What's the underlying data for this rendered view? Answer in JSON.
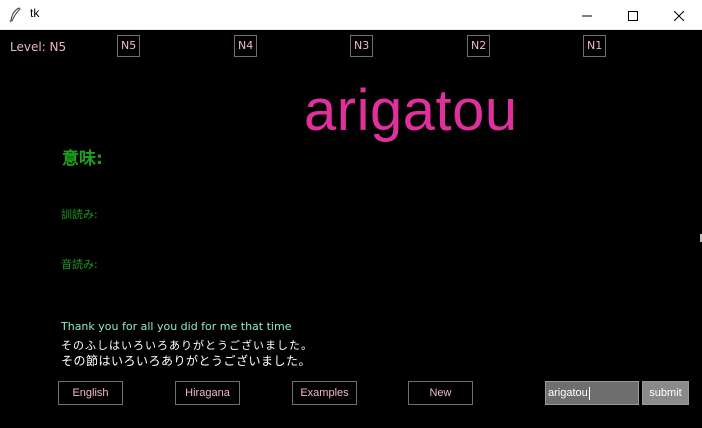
{
  "window": {
    "title": "tk",
    "icons": {
      "app": "feather-icon",
      "minimize": "minimize-icon",
      "maximize": "maximize-icon",
      "close": "close-icon"
    }
  },
  "level": {
    "label": "Level: N5",
    "buttons": [
      "N5",
      "N4",
      "N3",
      "N2",
      "N1"
    ]
  },
  "word": "arigatou",
  "meaning_label": "意味:",
  "kun_label": "訓読み:",
  "on_label": "音読み:",
  "example": {
    "english": "Thank you for all you did for me that time",
    "kana": "そのふしはいろいろありがとうございました。",
    "kanji": "その節はいろいろありがとうございました。"
  },
  "actions": {
    "english": "English",
    "hiragana": "Hiragana",
    "examples": "Examples",
    "new": "New"
  },
  "answer": {
    "value": "arigatou",
    "submit": "submit"
  },
  "colors": {
    "background": "#000000",
    "word": "#e0309c",
    "labels": "#1da21d",
    "english_example": "#8fe8c8",
    "button_text": "#f1b8cf"
  }
}
